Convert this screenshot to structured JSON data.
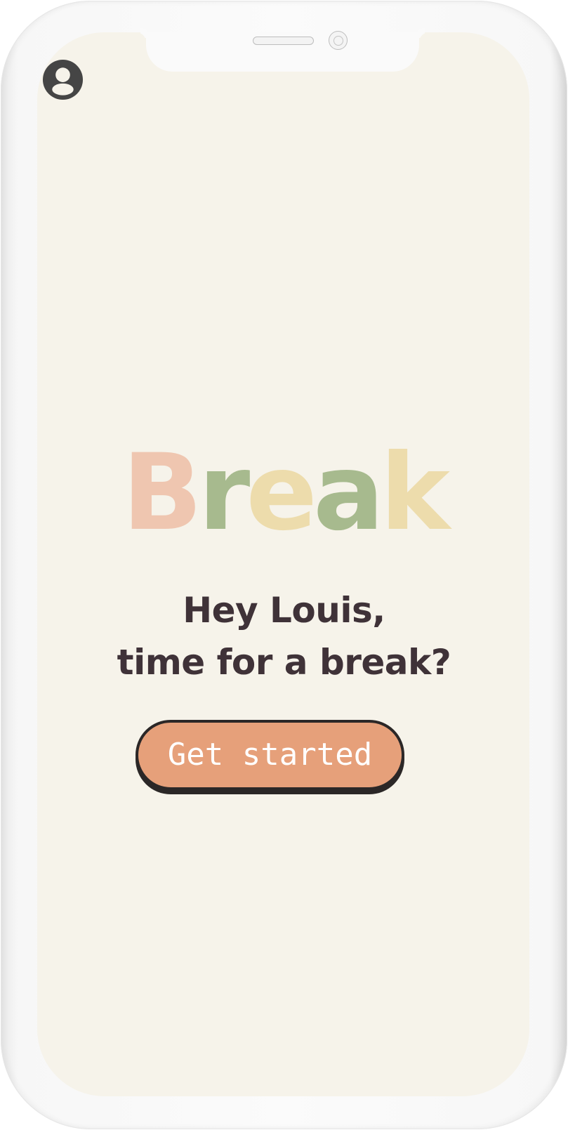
{
  "header": {
    "profile_icon": "user-circle-icon"
  },
  "brand": {
    "letters": [
      {
        "char": "B",
        "color": "#efc6b0"
      },
      {
        "char": "r",
        "color": "#a7ba8e"
      },
      {
        "char": "e",
        "color": "#eddcac"
      },
      {
        "char": "a",
        "color": "#a7ba8e"
      },
      {
        "char": "k",
        "color": "#eddcac"
      }
    ]
  },
  "greeting": {
    "line1": "Hey Louis,",
    "line2": "time for a break?"
  },
  "cta": {
    "label": "Get started"
  },
  "colors": {
    "background": "#f6f3ea",
    "text": "#3f3238",
    "button": "#e6a07a",
    "button_border": "#2b2727",
    "icon": "#454545"
  }
}
